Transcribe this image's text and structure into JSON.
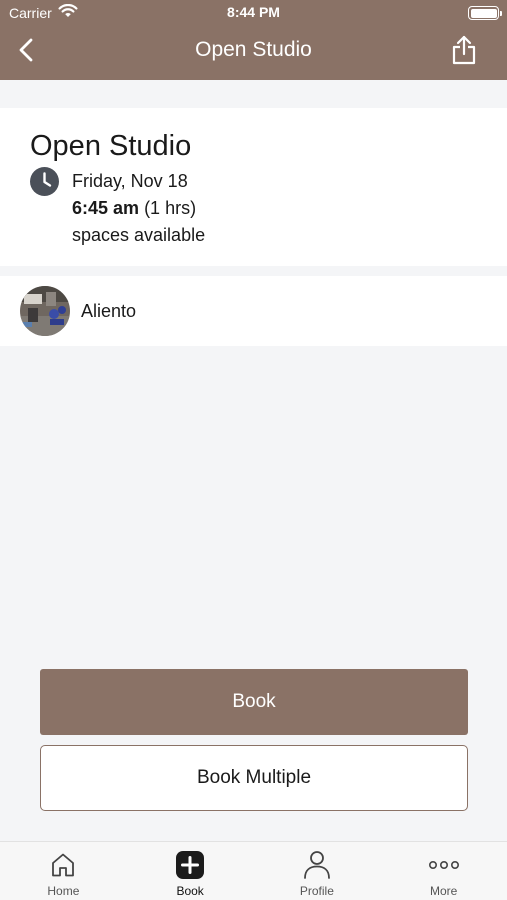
{
  "status_bar": {
    "carrier": "Carrier",
    "time": "8:44 PM",
    "battery_level": 1.0
  },
  "nav": {
    "title": "Open Studio",
    "back_icon": "chevron-left-icon",
    "share_icon": "share-icon"
  },
  "class_detail": {
    "name": "Open Studio",
    "date": "Friday, Nov 18",
    "time": "6:45 am",
    "duration": "(1 hrs)",
    "availability": "spaces available",
    "icon": "clock-icon"
  },
  "location": {
    "name": "Aliento",
    "avatar_icon": "studio-photo-avatar"
  },
  "actions": {
    "book_label": "Book",
    "book_multiple_label": "Book Multiple"
  },
  "tab_bar": {
    "items": [
      {
        "label": "Home",
        "icon": "home-icon"
      },
      {
        "label": "Book",
        "icon": "plus-square-icon"
      },
      {
        "label": "Profile",
        "icon": "person-icon"
      },
      {
        "label": "More",
        "icon": "more-dots-icon"
      }
    ],
    "active_index": 1
  },
  "colors": {
    "brand": "#8a7266",
    "background": "#f4f5f7",
    "card": "#ffffff",
    "icon_dark": "#4b5059"
  }
}
